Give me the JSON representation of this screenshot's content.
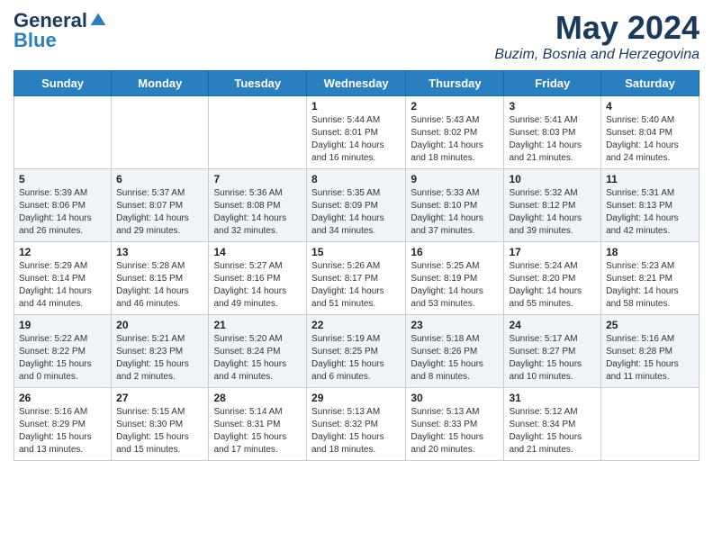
{
  "logo": {
    "general": "General",
    "blue": "Blue"
  },
  "title": "May 2024",
  "location": "Buzim, Bosnia and Herzegovina",
  "days_of_week": [
    "Sunday",
    "Monday",
    "Tuesday",
    "Wednesday",
    "Thursday",
    "Friday",
    "Saturday"
  ],
  "weeks": [
    [
      {
        "day": "",
        "text": ""
      },
      {
        "day": "",
        "text": ""
      },
      {
        "day": "",
        "text": ""
      },
      {
        "day": "1",
        "text": "Sunrise: 5:44 AM\nSunset: 8:01 PM\nDaylight: 14 hours and 16 minutes."
      },
      {
        "day": "2",
        "text": "Sunrise: 5:43 AM\nSunset: 8:02 PM\nDaylight: 14 hours and 18 minutes."
      },
      {
        "day": "3",
        "text": "Sunrise: 5:41 AM\nSunset: 8:03 PM\nDaylight: 14 hours and 21 minutes."
      },
      {
        "day": "4",
        "text": "Sunrise: 5:40 AM\nSunset: 8:04 PM\nDaylight: 14 hours and 24 minutes."
      }
    ],
    [
      {
        "day": "5",
        "text": "Sunrise: 5:39 AM\nSunset: 8:06 PM\nDaylight: 14 hours and 26 minutes."
      },
      {
        "day": "6",
        "text": "Sunrise: 5:37 AM\nSunset: 8:07 PM\nDaylight: 14 hours and 29 minutes."
      },
      {
        "day": "7",
        "text": "Sunrise: 5:36 AM\nSunset: 8:08 PM\nDaylight: 14 hours and 32 minutes."
      },
      {
        "day": "8",
        "text": "Sunrise: 5:35 AM\nSunset: 8:09 PM\nDaylight: 14 hours and 34 minutes."
      },
      {
        "day": "9",
        "text": "Sunrise: 5:33 AM\nSunset: 8:10 PM\nDaylight: 14 hours and 37 minutes."
      },
      {
        "day": "10",
        "text": "Sunrise: 5:32 AM\nSunset: 8:12 PM\nDaylight: 14 hours and 39 minutes."
      },
      {
        "day": "11",
        "text": "Sunrise: 5:31 AM\nSunset: 8:13 PM\nDaylight: 14 hours and 42 minutes."
      }
    ],
    [
      {
        "day": "12",
        "text": "Sunrise: 5:29 AM\nSunset: 8:14 PM\nDaylight: 14 hours and 44 minutes."
      },
      {
        "day": "13",
        "text": "Sunrise: 5:28 AM\nSunset: 8:15 PM\nDaylight: 14 hours and 46 minutes."
      },
      {
        "day": "14",
        "text": "Sunrise: 5:27 AM\nSunset: 8:16 PM\nDaylight: 14 hours and 49 minutes."
      },
      {
        "day": "15",
        "text": "Sunrise: 5:26 AM\nSunset: 8:17 PM\nDaylight: 14 hours and 51 minutes."
      },
      {
        "day": "16",
        "text": "Sunrise: 5:25 AM\nSunset: 8:19 PM\nDaylight: 14 hours and 53 minutes."
      },
      {
        "day": "17",
        "text": "Sunrise: 5:24 AM\nSunset: 8:20 PM\nDaylight: 14 hours and 55 minutes."
      },
      {
        "day": "18",
        "text": "Sunrise: 5:23 AM\nSunset: 8:21 PM\nDaylight: 14 hours and 58 minutes."
      }
    ],
    [
      {
        "day": "19",
        "text": "Sunrise: 5:22 AM\nSunset: 8:22 PM\nDaylight: 15 hours and 0 minutes."
      },
      {
        "day": "20",
        "text": "Sunrise: 5:21 AM\nSunset: 8:23 PM\nDaylight: 15 hours and 2 minutes."
      },
      {
        "day": "21",
        "text": "Sunrise: 5:20 AM\nSunset: 8:24 PM\nDaylight: 15 hours and 4 minutes."
      },
      {
        "day": "22",
        "text": "Sunrise: 5:19 AM\nSunset: 8:25 PM\nDaylight: 15 hours and 6 minutes."
      },
      {
        "day": "23",
        "text": "Sunrise: 5:18 AM\nSunset: 8:26 PM\nDaylight: 15 hours and 8 minutes."
      },
      {
        "day": "24",
        "text": "Sunrise: 5:17 AM\nSunset: 8:27 PM\nDaylight: 15 hours and 10 minutes."
      },
      {
        "day": "25",
        "text": "Sunrise: 5:16 AM\nSunset: 8:28 PM\nDaylight: 15 hours and 11 minutes."
      }
    ],
    [
      {
        "day": "26",
        "text": "Sunrise: 5:16 AM\nSunset: 8:29 PM\nDaylight: 15 hours and 13 minutes."
      },
      {
        "day": "27",
        "text": "Sunrise: 5:15 AM\nSunset: 8:30 PM\nDaylight: 15 hours and 15 minutes."
      },
      {
        "day": "28",
        "text": "Sunrise: 5:14 AM\nSunset: 8:31 PM\nDaylight: 15 hours and 17 minutes."
      },
      {
        "day": "29",
        "text": "Sunrise: 5:13 AM\nSunset: 8:32 PM\nDaylight: 15 hours and 18 minutes."
      },
      {
        "day": "30",
        "text": "Sunrise: 5:13 AM\nSunset: 8:33 PM\nDaylight: 15 hours and 20 minutes."
      },
      {
        "day": "31",
        "text": "Sunrise: 5:12 AM\nSunset: 8:34 PM\nDaylight: 15 hours and 21 minutes."
      },
      {
        "day": "",
        "text": ""
      }
    ]
  ]
}
